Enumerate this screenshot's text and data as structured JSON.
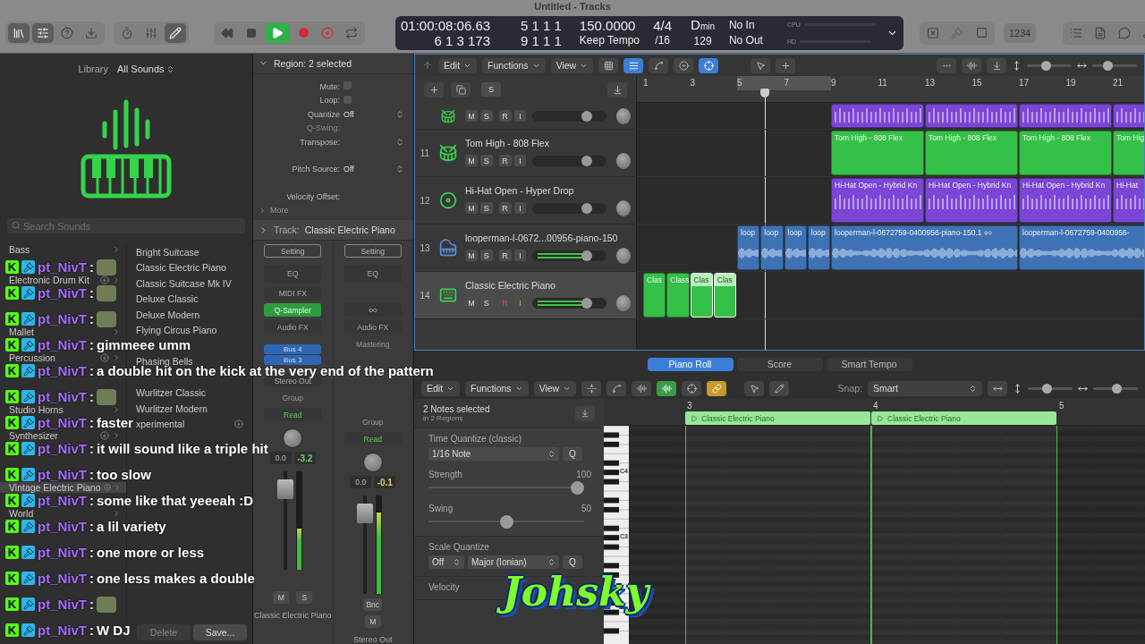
{
  "window": {
    "title": "Untitled - Tracks"
  },
  "toolbar": {
    "view_buttons": [
      {
        "on": true
      },
      {
        "on": true
      },
      {
        "on": false
      },
      {
        "on": false
      }
    ],
    "edit_buttons": [
      {
        "on": false
      },
      {
        "on": false
      },
      {
        "on": true
      }
    ],
    "transport": {
      "playing": true,
      "recording": false
    },
    "lcd": {
      "time": "01:00:08:06.63",
      "position": "6 1 3 173",
      "locator_start": "5 1 1 1",
      "locator_end": "9 1 1 1",
      "tempo": "150.0000",
      "tempo_mode": "Keep Tempo",
      "signature": "4/4",
      "division": "/16",
      "key": "D$_{min}$",
      "project_end": "129",
      "midi_in": "No In",
      "midi_out": "No Out",
      "cpu_label": "CPU",
      "hd_label": "HD"
    },
    "counter": "1234"
  },
  "library": {
    "title": "Library",
    "filter": "All Sounds",
    "search_placeholder": "Search Sounds",
    "categories": [
      {
        "label": "Bass",
        "download": false,
        "selected": false
      },
      {
        "label": "Electronic Drum Kit",
        "download": true,
        "selected": false
      },
      {
        "label": "Mallet",
        "download": false,
        "selected": false
      },
      {
        "label": "Percussion",
        "download": true,
        "selected": false
      },
      {
        "label": "Studio Horns",
        "download": false,
        "selected": false
      },
      {
        "label": "Synthesizer",
        "download": true,
        "selected": false
      },
      {
        "label": "Vintage Electric Piano",
        "download": true,
        "selected": true
      },
      {
        "label": "World",
        "download": false,
        "selected": false
      }
    ],
    "sounds": [
      {
        "label": "Bright Suitcase",
        "download": false
      },
      {
        "label": "Classic Electric Piano",
        "download": false
      },
      {
        "label": "Classic Suitcase Mk IV",
        "download": false
      },
      {
        "label": "Deluxe Classic",
        "download": false
      },
      {
        "label": "Deluxe Modern",
        "download": false
      },
      {
        "label": "Flying Circus Piano",
        "download": false
      },
      {
        "label": "Phasing Bells",
        "download": false
      },
      {
        "label": "Wurlitzer Classic",
        "download": false
      },
      {
        "label": "Wurlitzer Modern",
        "download": false
      },
      {
        "label": "xperimental",
        "download": true
      }
    ],
    "buttons": [
      "Delete",
      "Save..."
    ]
  },
  "inspector": {
    "region": {
      "title": "Region: 2 selected",
      "expanded": true,
      "fields": [
        {
          "kind": "checkbox",
          "label": "Mute:",
          "checked": false
        },
        {
          "kind": "checkbox",
          "label": "Loop:",
          "checked": false
        },
        {
          "kind": "select",
          "label": "Quantize",
          "value": "Off"
        },
        {
          "kind": "disabled",
          "label": "Q-Swing:"
        },
        {
          "kind": "select",
          "label": "Transpose:"
        },
        {
          "kind": "select",
          "label": "Pitch Source:",
          "value": "Off"
        },
        {
          "kind": "plain",
          "label": "Velocity Offset:"
        }
      ],
      "more": "More"
    },
    "track": {
      "title": "Track:",
      "name": "Classic Electric Piano",
      "expanded": false
    },
    "strips": [
      {
        "setting": "Setting",
        "eq": "EQ",
        "midi_fx": "MIDI FX",
        "instrument": "Q-Sampler",
        "link": false,
        "audio_fx": [
          "Audio FX"
        ],
        "sends": [
          "Bus 4",
          "Bus 3"
        ],
        "output": "Stereo Out",
        "group": "Group",
        "automation": "Read",
        "volume": "0.0",
        "peak": {
          "text": "-3.2",
          "color": "#6fd06f"
        },
        "fader": {
          "level": 0.82
        },
        "meter": {
          "level": 0.42
        },
        "buttons": [
          "M",
          "S"
        ],
        "name": "Classic Electric Piano"
      },
      {
        "setting": "Setting",
        "eq": "EQ",
        "link": true,
        "audio_fx": [
          "Audio FX",
          "Mastering"
        ],
        "group": "Group",
        "automation": "Read",
        "volume": "0.0",
        "peak": {
          "text": "-0.1",
          "color": "#d8d05a"
        },
        "fader": {
          "level": 0.82
        },
        "meter": {
          "level": 0.83
        },
        "bounce": "Bnc",
        "buttons": [
          "M"
        ],
        "name": "Stereo Out"
      }
    ]
  },
  "tracks_area": {
    "menus": [
      "Edit",
      "Functions",
      "View"
    ],
    "tools": [
      {
        "on": false
      },
      {
        "on": true
      },
      {
        "on": false
      },
      {
        "on": false
      },
      {
        "on": true
      }
    ],
    "zoom_sliders": [
      {
        "level": 0.4
      },
      {
        "level": 0.3
      }
    ],
    "header_buttons": [
      "S"
    ],
    "ruler": [
      "1",
      "3",
      "5",
      "7",
      "9",
      "11",
      "13",
      "15",
      "17",
      "19",
      "21"
    ],
    "tracks": [
      {
        "kind": "partial",
        "buttons": [
          "M",
          "S",
          "R",
          "I"
        ],
        "record": false,
        "monitor": false,
        "selected": false,
        "fader": {
          "level": 0.78,
          "active": false
        },
        "regions": [
          {
            "kind": "midi",
            "color": "#7b45d6",
            "selected": false
          },
          {
            "kind": "midi",
            "color": "#7b45d6",
            "selected": false
          },
          {
            "kind": "midi",
            "color": "#7b45d6",
            "selected": false
          },
          {
            "kind": "midi",
            "color": "#7b45d6",
            "selected": false
          }
        ]
      },
      {
        "kind": "full",
        "number": "11",
        "name": "Tom High - 808 Flex",
        "buttons": [
          "M",
          "S",
          "R",
          "I"
        ],
        "record": false,
        "monitor": false,
        "selected": false,
        "fader": {
          "level": 0.78,
          "active": false
        },
        "regions": [
          {
            "kind": "pattern",
            "color": "#35c147",
            "label": "Tom High - 808 Flex",
            "selected": false
          },
          {
            "kind": "pattern",
            "color": "#35c147",
            "label": "Tom High - 808 Flex",
            "selected": false
          },
          {
            "kind": "pattern",
            "color": "#35c147",
            "label": "Tom High - 808 Flex",
            "selected": false
          },
          {
            "kind": "pattern",
            "color": "#35c147",
            "label": "Tom Hig",
            "selected": false
          }
        ]
      },
      {
        "kind": "full",
        "number": "12",
        "name": "Hi-Hat Open - Hyper Drop",
        "buttons": [
          "M",
          "S",
          "R",
          "I"
        ],
        "record": false,
        "monitor": false,
        "selected": false,
        "fader": {
          "level": 0.78,
          "active": false
        },
        "regions": [
          {
            "kind": "midi",
            "color": "#7b45d6",
            "label": "Hi-Hat Open - Hybrid Kn",
            "selected": false
          },
          {
            "kind": "midi",
            "color": "#7b45d6",
            "label": "Hi-Hat Open - Hybrid Kn",
            "selected": false
          },
          {
            "kind": "midi",
            "color": "#7b45d6",
            "label": "Hi-Hat Open - Hybrid Kn",
            "selected": false
          },
          {
            "kind": "midi",
            "color": "#7b45d6",
            "label": "Hi-Hat",
            "selected": false
          }
        ]
      },
      {
        "kind": "full",
        "number": "13",
        "name": "looperman-l-0672...00956-piano-150",
        "buttons": [
          "M",
          "S",
          "R",
          "I"
        ],
        "record": false,
        "monitor": false,
        "selected": false,
        "fader": {
          "level": 0.78,
          "active": true
        },
        "regions": [
          {
            "kind": "audio",
            "color": "#3f72b5",
            "label": "loop",
            "selected": false
          },
          {
            "kind": "audio",
            "color": "#3f72b5",
            "label": "loop",
            "selected": false
          },
          {
            "kind": "audio",
            "color": "#3f72b5",
            "label": "loop",
            "selected": false
          },
          {
            "kind": "audio",
            "color": "#3f72b5",
            "label": "loop",
            "selected": false
          },
          {
            "kind": "audio",
            "color": "#3f72b5",
            "label": "looperman-l-0672759-0400956-piano-150.1",
            "linked": true,
            "selected": false
          },
          {
            "kind": "audio",
            "color": "#3f72b5",
            "label": "looperman-l-0672759-0400956-",
            "selected": false
          }
        ]
      },
      {
        "kind": "full",
        "number": "14",
        "name": "Classic Electric Piano",
        "buttons": [
          "M",
          "S",
          "R",
          "I"
        ],
        "record": true,
        "monitor": true,
        "selected": true,
        "fader": {
          "level": 0.78,
          "active": true
        },
        "regions": [
          {
            "kind": "pattern",
            "color": "#35c147",
            "label": "Clas",
            "selected": false
          },
          {
            "kind": "pattern",
            "color": "#35c147",
            "label": "Class",
            "selected": false
          },
          {
            "kind": "pattern",
            "color": "#35c147",
            "label": "Clas",
            "selected": true
          },
          {
            "kind": "pattern",
            "color": "#35c147",
            "label": "Clas",
            "selected": true
          }
        ]
      }
    ]
  },
  "editor": {
    "tabs": [
      {
        "label": "Piano Roll",
        "selected": true
      },
      {
        "label": "Score",
        "selected": false
      },
      {
        "label": "Smart Tempo",
        "selected": false
      }
    ],
    "menus": [
      "Edit",
      "Functions",
      "View"
    ],
    "tools": [
      {
        "on": false
      },
      {
        "on": false
      },
      {
        "on": false
      },
      {
        "on": true
      },
      {
        "on": false
      },
      {
        "on": true
      }
    ],
    "snap_label": "Snap:",
    "snap": "Smart",
    "zoom_sliders": [
      {
        "level": 0.4
      },
      {
        "level": 0.55
      }
    ],
    "selection": "2 Notes selected",
    "selection_detail": "in 2 Regions",
    "time_quantize": {
      "title": "Time Quantize (classic)",
      "value": "1/16 Note",
      "button": "Q"
    },
    "sliders": [
      {
        "label": "Strength",
        "reading": "100",
        "level": 1.0
      },
      {
        "label": "Swing",
        "reading": "50",
        "level": 0.5
      }
    ],
    "scale_quantize": {
      "title": "Scale Quantize",
      "mode": "Off",
      "scale": "Major (Ionian)",
      "button": "Q"
    },
    "velocity_label": "Velocity",
    "keyboard_labels": [
      "C4",
      "C3"
    ],
    "ruler": [
      "3",
      "4",
      "5"
    ],
    "regions": [
      {
        "label": "Classic Electric Piano"
      },
      {
        "label": "Classic Electric Piano"
      }
    ]
  },
  "chat": {
    "messages": [
      {
        "badge": "K",
        "user": "pt_NivT",
        "separator": ":",
        "kind": "emote"
      },
      {
        "badge": "K",
        "user": "pt_NivT",
        "separator": ":",
        "kind": "emote"
      },
      {
        "badge": "K",
        "user": "pt_NivT",
        "separator": ":",
        "kind": "emote"
      },
      {
        "badge": "K",
        "user": "pt_NivT",
        "separator": ":",
        "kind": "text",
        "text": "gimmeee umm"
      },
      {
        "badge": "K",
        "user": "pt_NivT",
        "separator": ":",
        "kind": "text",
        "text": "a double hit on the kick at the very end of the pattern"
      },
      {
        "badge": "K",
        "user": "pt_NivT",
        "separator": ":",
        "kind": "emote"
      },
      {
        "badge": "K",
        "user": "pt_NivT",
        "separator": ":",
        "kind": "text",
        "text": "faster"
      },
      {
        "badge": "K",
        "user": "pt_NivT",
        "separator": ":",
        "kind": "text",
        "text": "it will sound like a triple hit"
      },
      {
        "badge": "K",
        "user": "pt_NivT",
        "separator": ":",
        "kind": "text",
        "text": "too slow"
      },
      {
        "badge": "K",
        "user": "pt_NivT",
        "separator": ":",
        "kind": "text",
        "text": "some like that yeeeah :D"
      },
      {
        "badge": "K",
        "user": "pt_NivT",
        "separator": ":",
        "kind": "text",
        "text": "a lil variety"
      },
      {
        "badge": "K",
        "user": "pt_NivT",
        "separator": ":",
        "kind": "text",
        "text": "one more or less"
      },
      {
        "badge": "K",
        "user": "pt_NivT",
        "separator": ":",
        "kind": "text",
        "text": "one less makes a double"
      },
      {
        "badge": "K",
        "user": "pt_NivT",
        "separator": ":",
        "kind": "emote"
      },
      {
        "badge": "K",
        "user": "pt_NivT",
        "separator": ":",
        "kind": "text",
        "text": "W DJ"
      }
    ]
  },
  "overlay_logo": "Johsky"
}
